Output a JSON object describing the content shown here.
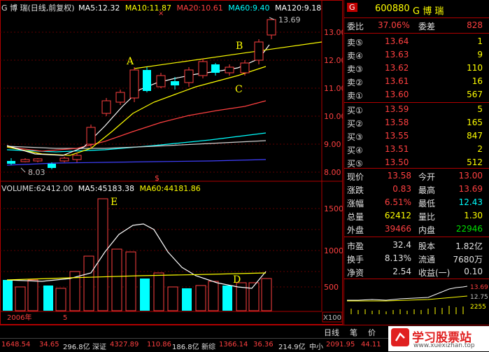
{
  "kline": {
    "header_name": "G 博  瑞(日线,前复权)",
    "ma5": "MA5:12.32",
    "ma10": "MA10:11.87",
    "ma20": "MA20:10.61",
    "ma60": "MA60:9.40",
    "ma120": "MA120:9.18",
    "price_ticks": [
      "13.00",
      "12.00",
      "11.00",
      "10.00",
      "9.00",
      "8.00"
    ],
    "high_label": "13.69",
    "low_label": "8.03",
    "annotation_a": "A",
    "annotation_b": "B",
    "annotation_c": "C",
    "marker_s": "$",
    "marker_x": "×",
    "colors": {
      "ma5": "#ffffff",
      "ma10": "#ffff00",
      "ma20": "#ff4040",
      "ma60": "#00ffff",
      "ma120": "#4040ff",
      "up": "#ff4040",
      "down": "#00ffff",
      "trend": "#ffff00"
    }
  },
  "volume": {
    "header": "VOLUME:62412.00",
    "ma5": "MA5:45183.38",
    "ma60": "MA60:44181.86",
    "ticks": [
      "1500",
      "1000",
      "500"
    ],
    "unit": "X100",
    "annotation_e": "E",
    "annotation_d": "D",
    "year_label": "2006年",
    "month_label": "5"
  },
  "quote": {
    "code_box": "G",
    "code": "600880",
    "name": "G 博  瑞",
    "wei_bi_label": "委比",
    "wei_bi": "37.06%",
    "wei_cha_label": "委差",
    "wei_cha": "828",
    "sell": [
      {
        "label": "卖⑤",
        "price": "13.64",
        "vol": "1"
      },
      {
        "label": "卖④",
        "price": "13.63",
        "vol": "9"
      },
      {
        "label": "卖③",
        "price": "13.62",
        "vol": "110"
      },
      {
        "label": "卖②",
        "price": "13.61",
        "vol": "16"
      },
      {
        "label": "卖①",
        "price": "13.60",
        "vol": "567"
      }
    ],
    "buy": [
      {
        "label": "买①",
        "price": "13.59",
        "vol": "5"
      },
      {
        "label": "买②",
        "price": "13.58",
        "vol": "165"
      },
      {
        "label": "买③",
        "price": "13.55",
        "vol": "847"
      },
      {
        "label": "买④",
        "price": "13.51",
        "vol": "2"
      },
      {
        "label": "买⑤",
        "price": "13.50",
        "vol": "512"
      }
    ],
    "stats": [
      {
        "l1": "现价",
        "v1": "13.58",
        "l2": "今开",
        "v2": "13.00"
      },
      {
        "l1": "涨跌",
        "v1": "0.83",
        "l2": "最高",
        "v2": "13.69"
      },
      {
        "l1": "涨幅",
        "v1": "6.51%",
        "l2": "最低",
        "v2": "12.43"
      },
      {
        "l1": "总量",
        "v1": "62412",
        "l2": "量比",
        "v2": "1.30"
      },
      {
        "l1": "外盘",
        "v1": "39466",
        "l2": "内盘",
        "v2": "22946"
      }
    ],
    "fund": [
      {
        "l1": "市盈",
        "v1": "32.4",
        "l2": "股本",
        "v2": "1.82亿"
      },
      {
        "l1": "换手",
        "v1": "8.13%",
        "l2": "流通",
        "v2": "7680万"
      },
      {
        "l1": "净资",
        "v1": "2.54",
        "l2": "收益(一)",
        "v2": "0.10"
      }
    ],
    "mini_ticks": [
      "13.69",
      "12.75",
      "2255"
    ]
  },
  "tabs": {
    "daily": "日线",
    "bi": "笔",
    "jia": "价"
  },
  "status": {
    "sh_index": "1648.54",
    "sh_change": "34.65",
    "sh_amount": "296.8亿",
    "sz_label": "深证",
    "sz_index": "4327.89",
    "sz_change": "110.86",
    "sz_amount": "186.8亿",
    "new_label": "新综",
    "new_index": "1366.14",
    "new_change": "36.36",
    "new_amount": "214.9亿",
    "small_label": "中小",
    "small_index": "2091.95",
    "small_change": "44.11"
  },
  "logo": {
    "text": "学习股票站",
    "url": "www.xuexizhan.top"
  }
}
